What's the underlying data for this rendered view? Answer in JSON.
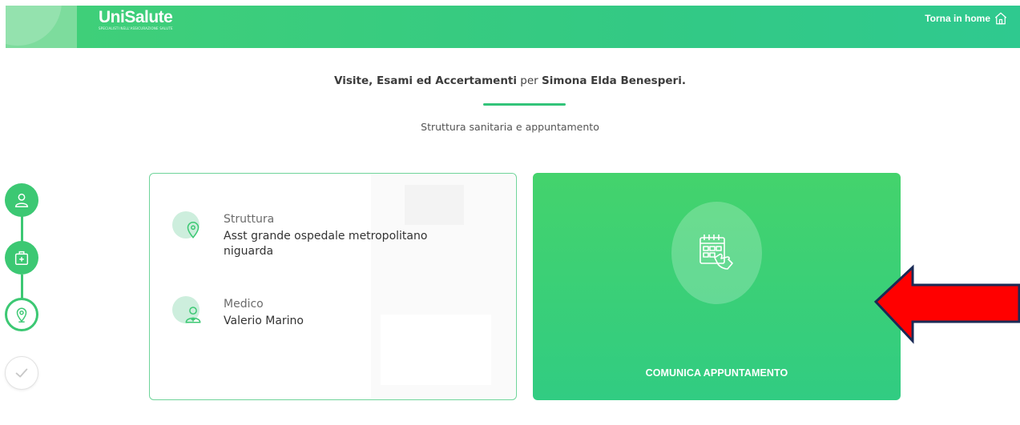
{
  "header": {
    "brand_name": "UniSalute",
    "brand_tagline": "SPECIALISTI NELL'ASSICURAZIONE SALUTE",
    "home_link": "Torna in home"
  },
  "page": {
    "title_part1": "Visite, Esami ed Accertamenti",
    "title_mid": " per ",
    "title_name": "Simona Elda Benesperi.",
    "subtitle": "Struttura sanitaria e appuntamento"
  },
  "stepper": {
    "steps": [
      {
        "icon": "user-icon",
        "state": "done"
      },
      {
        "icon": "medical-kit-icon",
        "state": "done"
      },
      {
        "icon": "location-pin-icon",
        "state": "active"
      },
      {
        "icon": "checkmark-icon",
        "state": "pending"
      }
    ]
  },
  "info": {
    "struttura_label": "Struttura",
    "struttura_value": "Asst grande ospedale metropolitano niguarda",
    "medico_label": "Medico",
    "medico_value": "Valerio Marino"
  },
  "action": {
    "label": "COMUNICA APPUNTAMENTO",
    "icon": "calendar-touch-icon"
  },
  "colors": {
    "accent": "#3cc873",
    "header_green": "#35c876",
    "action_green": "#38cf78",
    "arrow_red": "#ff0000"
  }
}
